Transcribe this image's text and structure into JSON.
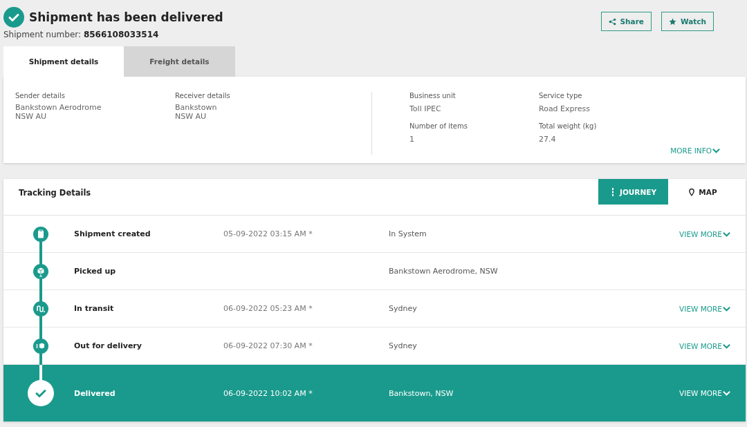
{
  "header": {
    "title": "Shipment has been delivered",
    "number_label": "Shipment number:",
    "number": "8566108033514",
    "actions": [
      {
        "kind": "share",
        "label": "Share"
      },
      {
        "kind": "watch",
        "label": "Watch"
      }
    ]
  },
  "tabs": [
    {
      "label": "Shipment details",
      "selected": true
    },
    {
      "label": "Freight details",
      "selected": false
    }
  ],
  "details": {
    "left": [
      {
        "label": "Sender details",
        "lines": [
          "Bankstown Aerodrome",
          "NSW AU"
        ]
      },
      {
        "label": "Receiver details",
        "lines": [
          "Bankstown",
          "NSW AU"
        ]
      }
    ],
    "right": [
      {
        "label": "Business unit",
        "value": "Toll IPEC"
      },
      {
        "label": "Service type",
        "value": "Road Express"
      },
      {
        "label": "Number of items",
        "value": "1"
      },
      {
        "label": "Total weight (kg)",
        "value": "27.4"
      }
    ],
    "more_info": "MORE INFO"
  },
  "tracking": {
    "title": "Tracking Details",
    "views": [
      {
        "kind": "journey",
        "label": "JOURNEY",
        "selected": true
      },
      {
        "kind": "map",
        "label": "MAP",
        "selected": false
      }
    ],
    "events": [
      {
        "kind": "created",
        "name": "Shipment created",
        "date": "05-09-2022 03:15 AM *",
        "location": "In System",
        "view_more": "VIEW MORE",
        "selected": false
      },
      {
        "kind": "picked",
        "name": "Picked up",
        "location": "Bankstown Aerodrome, NSW",
        "selected": false
      },
      {
        "kind": "transit",
        "name": "In transit",
        "date": "06-09-2022 05:23 AM *",
        "location": "Sydney",
        "view_more": "VIEW MORE",
        "selected": false
      },
      {
        "kind": "out",
        "name": "Out for delivery",
        "date": "06-09-2022 07:30 AM *",
        "location": "Sydney",
        "view_more": "VIEW MORE",
        "selected": false
      },
      {
        "kind": "delivered",
        "name": "Delivered",
        "date": "06-09-2022 10:02 AM *",
        "location": "Bankstown, NSW",
        "view_more": "VIEW MORE",
        "selected": true
      }
    ]
  }
}
